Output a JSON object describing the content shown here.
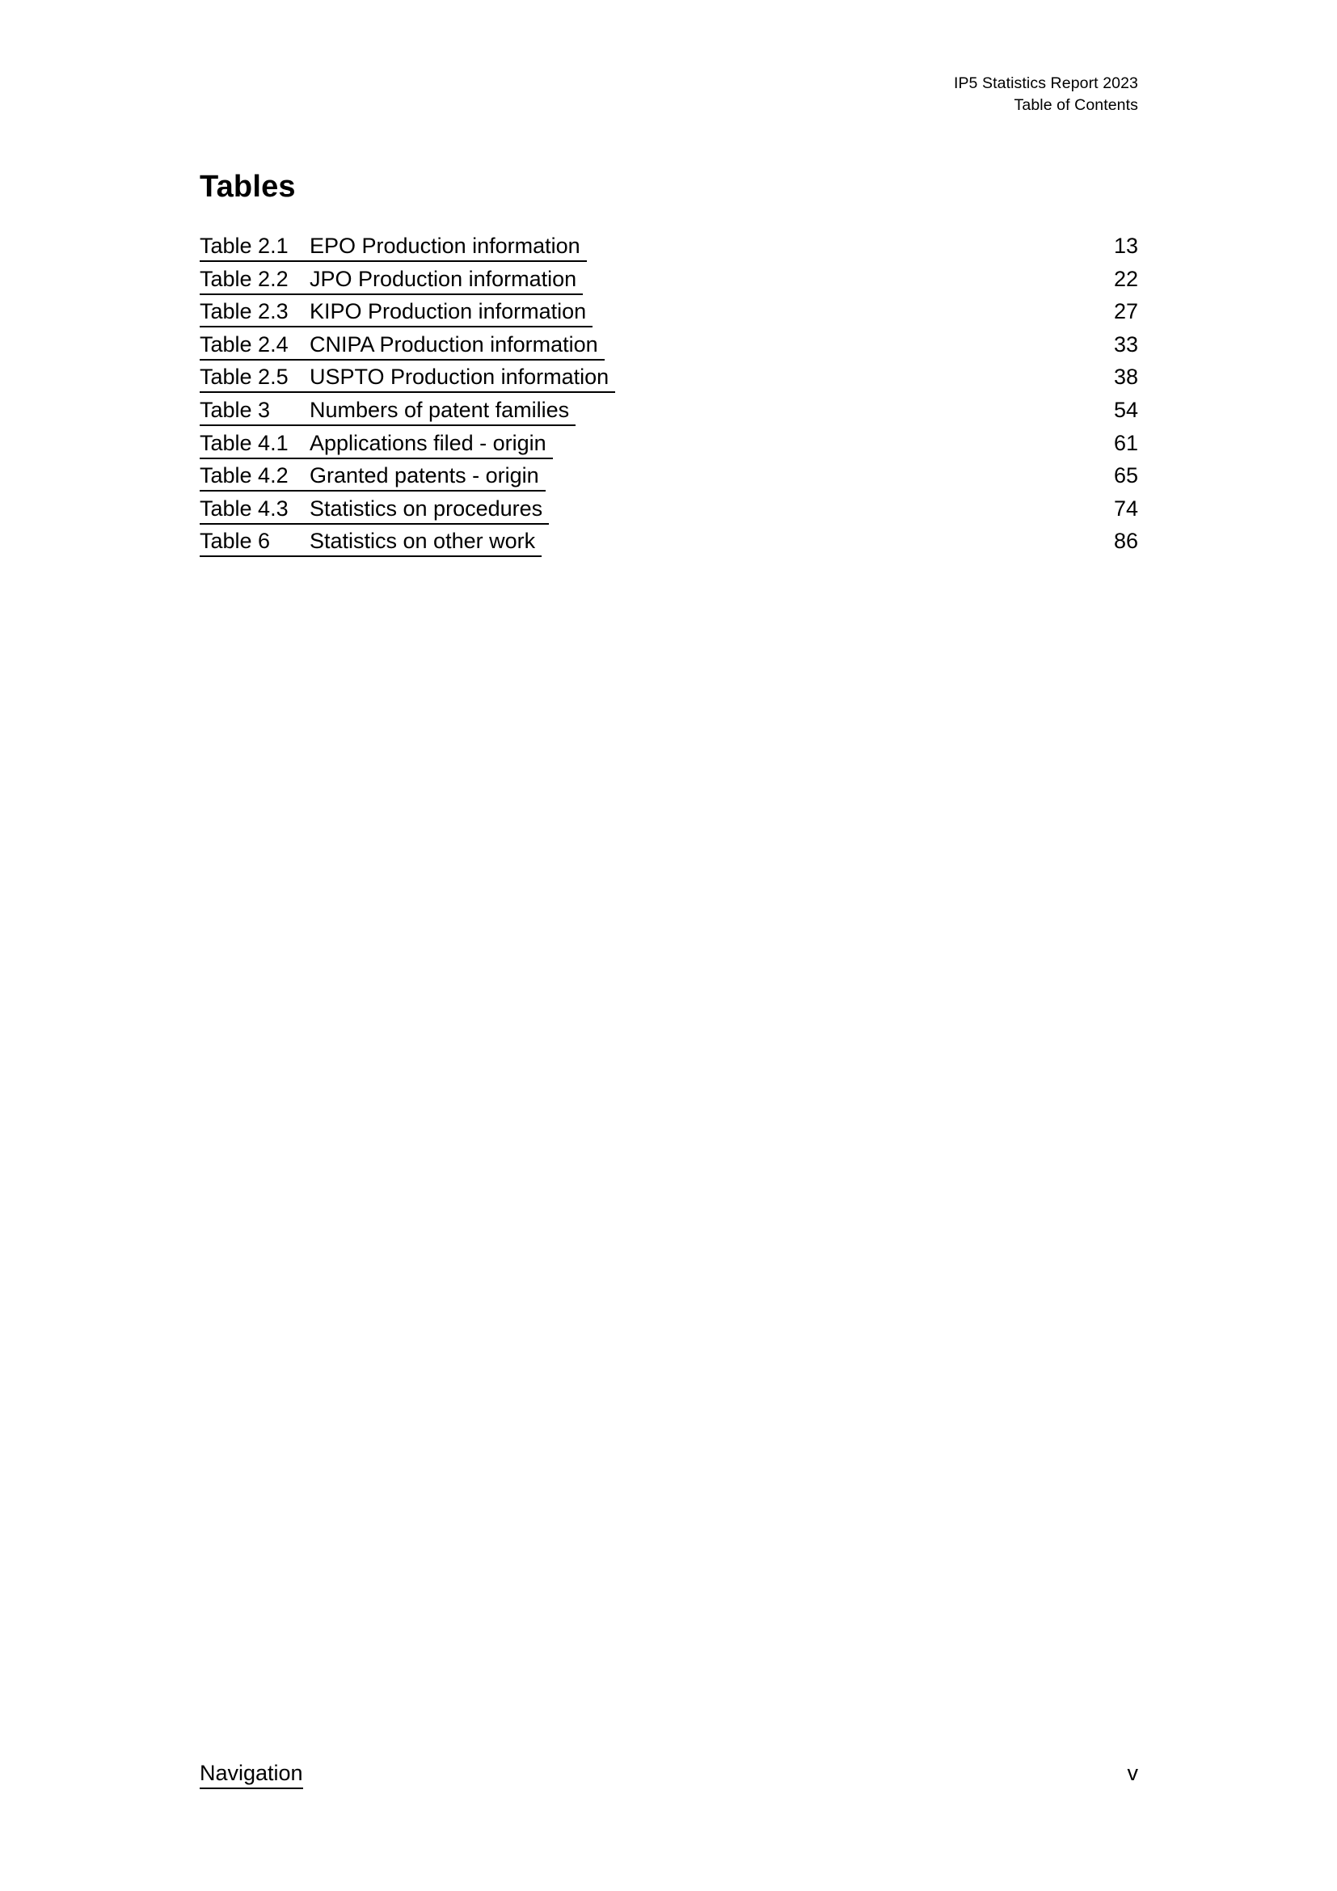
{
  "header": {
    "line1": "IP5 Statistics Report 2023",
    "line2": "Table of Contents"
  },
  "title": "Tables",
  "toc": {
    "entries": [
      {
        "label": "Table 2.1",
        "title": "EPO Production information",
        "page": "13"
      },
      {
        "label": "Table 2.2",
        "title": "JPO Production information",
        "page": "22"
      },
      {
        "label": "Table 2.3",
        "title": "KIPO Production information",
        "page": "27"
      },
      {
        "label": "Table 2.4",
        "title": "CNIPA Production information",
        "page": "33"
      },
      {
        "label": "Table 2.5",
        "title": "USPTO Production information",
        "page": "38"
      },
      {
        "label": "Table 3",
        "title": "Numbers of patent families",
        "page": "54"
      },
      {
        "label": "Table 4.1",
        "title": "Applications filed - origin",
        "page": "61"
      },
      {
        "label": "Table 4.2",
        "title": "Granted patents - origin",
        "page": "65"
      },
      {
        "label": "Table 4.3",
        "title": "Statistics on procedures",
        "page": "74"
      },
      {
        "label": "Table 6",
        "title": "Statistics on other work",
        "page": "86"
      }
    ]
  },
  "footer": {
    "navigation_label": "Navigation",
    "page_number": "v"
  },
  "colors": {
    "text": "#000000",
    "background": "#ffffff"
  }
}
